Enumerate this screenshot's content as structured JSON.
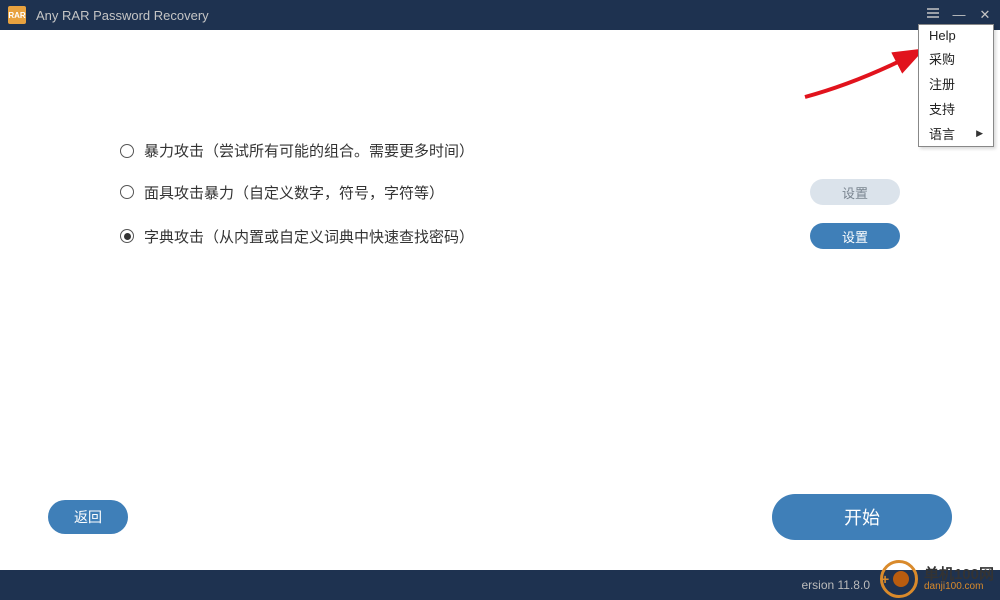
{
  "titlebar": {
    "app_icon_text": "RAR",
    "title": "Any RAR Password Recovery"
  },
  "menu": {
    "items": [
      {
        "label": "Help",
        "has_submenu": false
      },
      {
        "label": "采购",
        "has_submenu": false
      },
      {
        "label": "注册",
        "has_submenu": false
      },
      {
        "label": "支持",
        "has_submenu": false
      },
      {
        "label": "语言",
        "has_submenu": true
      }
    ]
  },
  "options": [
    {
      "label": "暴力攻击（尝试所有可能的组合。需要更多时间）",
      "selected": false,
      "has_settings": false
    },
    {
      "label": "面具攻击暴力（自定义数字，符号，字符等）",
      "selected": false,
      "has_settings": true,
      "settings_active": false
    },
    {
      "label": "字典攻击（从内置或自定义词典中快速查找密码）",
      "selected": true,
      "has_settings": true,
      "settings_active": true
    }
  ],
  "buttons": {
    "settings": "设置",
    "back": "返回",
    "start": "开始"
  },
  "footer": {
    "version": "ersion 11.8.0"
  },
  "watermark": {
    "text_top": "单机100网",
    "text_bot": "danji100.com"
  }
}
